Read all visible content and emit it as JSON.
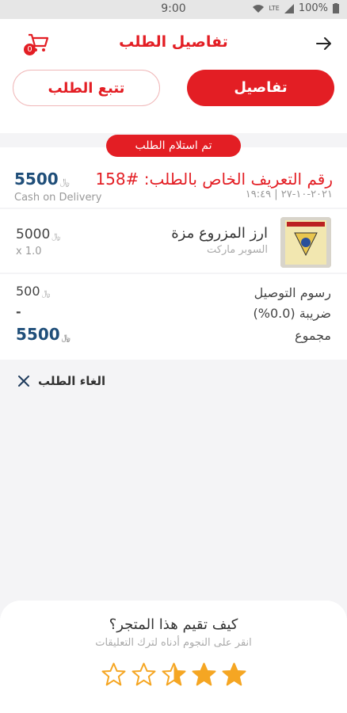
{
  "status_bar": {
    "time": "9:00",
    "network": "LTE",
    "battery": "100%"
  },
  "header": {
    "title": "تفاصيل الطلب",
    "cart_count": "0"
  },
  "tabs": {
    "details": "تفاصيل",
    "track": "تتبع الطلب"
  },
  "order_status": "تم استلام الطلب",
  "order": {
    "id_label": "رقم التعريف الخاص بالطلب: #158",
    "date": "٢٠٢١-١٠-٢٧ | ١٩:٤٩",
    "total": "5500",
    "currency": "﷼",
    "payment_method": "Cash on Delivery"
  },
  "item": {
    "name": "ارز المزروع مزة",
    "store": "السوبر ماركت",
    "price": "5000",
    "quantity": "x 1.0"
  },
  "summary": {
    "delivery_label": "رسوم التوصيل",
    "delivery_value": "500",
    "tax_label": "ضريبة (0.0%)",
    "tax_value": "-",
    "total_label": "مجموع",
    "total_value": "5500"
  },
  "cancel_label": "الغاء الطلب",
  "rating": {
    "question": "كيف تقيم هذا المتجر؟",
    "hint": "انقر على النجوم أدناه لترك التعليقات",
    "value": 2.5,
    "max": 5
  },
  "colors": {
    "accent": "#e31e24",
    "price_blue": "#1f4e79",
    "star": "#f5a623"
  },
  "icons": [
    "back-arrow-icon",
    "cart-icon",
    "close-icon",
    "star-icon"
  ]
}
